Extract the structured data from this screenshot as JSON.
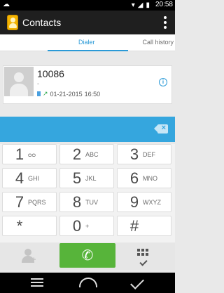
{
  "status_bar": {
    "time": "20:58",
    "left_icon": "cloud-icon",
    "icons": [
      "wifi-icon",
      "signal-icon",
      "battery-icon"
    ]
  },
  "app_bar": {
    "title": "Contacts",
    "menu_icon": "overflow-menu-icon"
  },
  "tabs": [
    {
      "label": "Dialer",
      "active": true
    },
    {
      "label": "Call history",
      "active": false
    }
  ],
  "contact": {
    "number": "10086",
    "subtitle": "-",
    "date": "01-21-2015",
    "time": "16:50"
  },
  "dialpad": {
    "keys": [
      {
        "digit": "1",
        "letters": ""
      },
      {
        "digit": "2",
        "letters": "ABC"
      },
      {
        "digit": "3",
        "letters": "DEF"
      },
      {
        "digit": "4",
        "letters": "GHI"
      },
      {
        "digit": "5",
        "letters": "JKL"
      },
      {
        "digit": "6",
        "letters": "MNO"
      },
      {
        "digit": "7",
        "letters": "PQRS"
      },
      {
        "digit": "8",
        "letters": "TUV"
      },
      {
        "digit": "9",
        "letters": "WXYZ"
      },
      {
        "digit": "*",
        "letters": ""
      },
      {
        "digit": "0",
        "letters": "+"
      },
      {
        "digit": "#",
        "letters": ""
      }
    ]
  },
  "colors": {
    "accent": "#2b9ad7",
    "number_bar": "#35a6de",
    "call": "#57b43a"
  }
}
